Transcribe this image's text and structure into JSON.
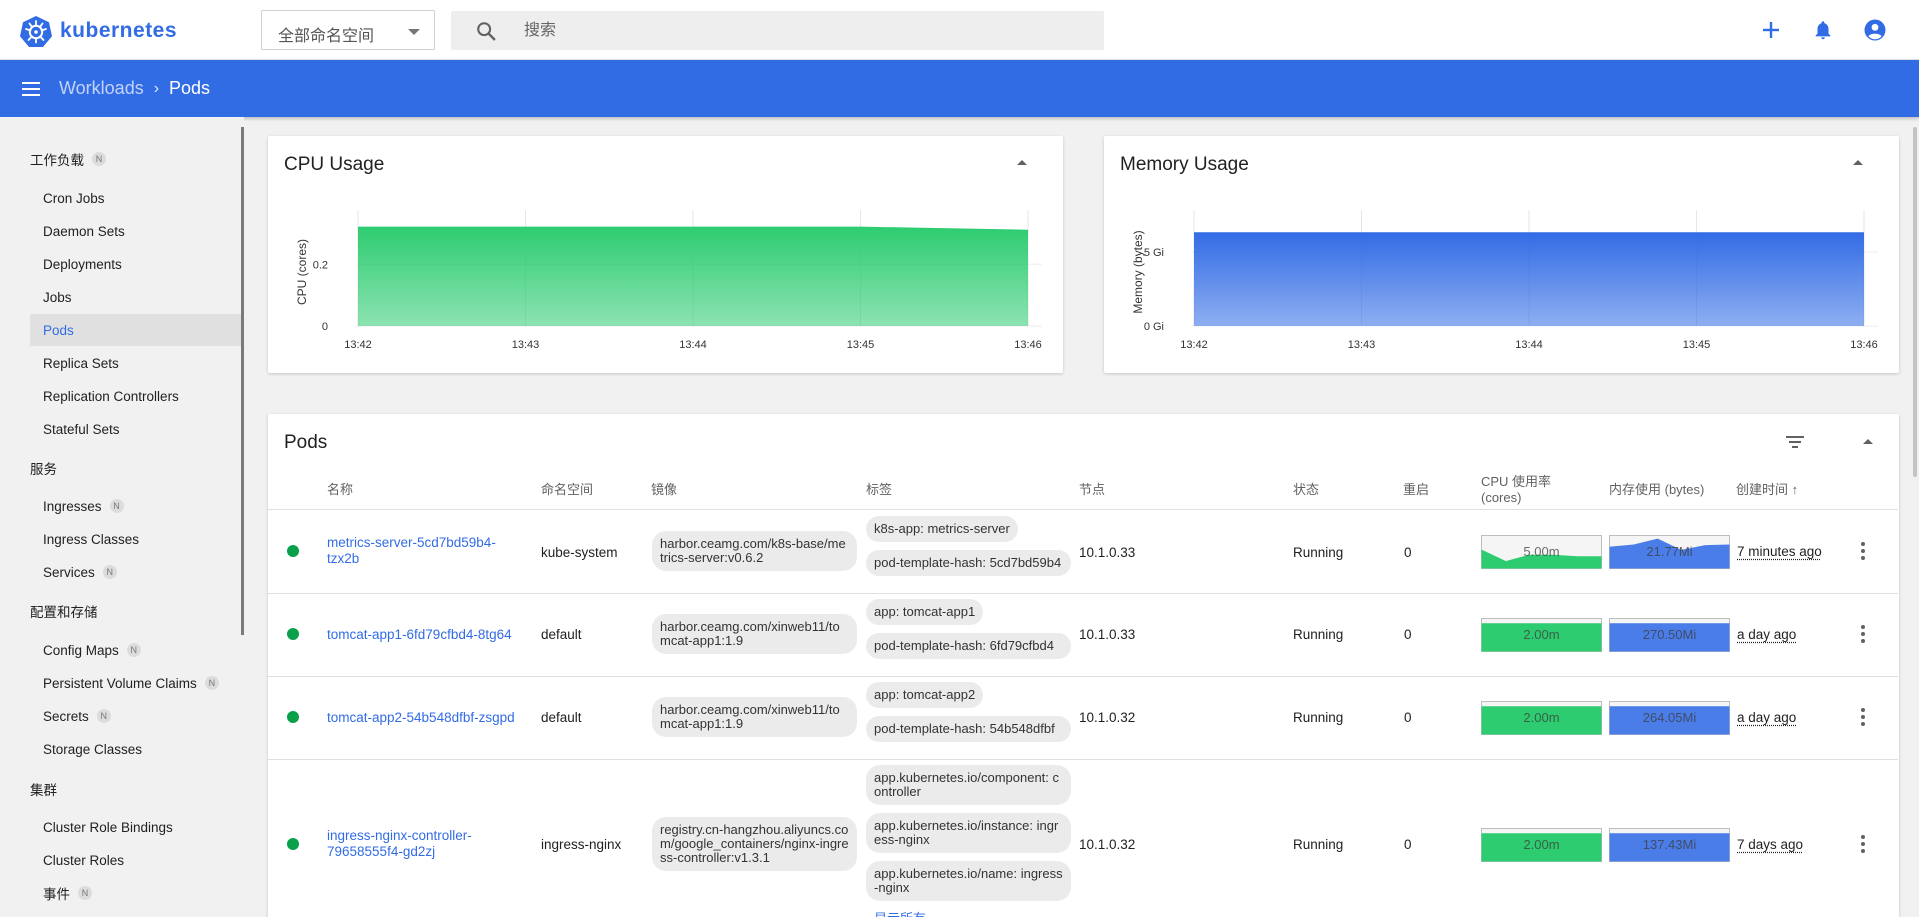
{
  "app": {
    "name": "kubernetes"
  },
  "namespace": {
    "selected": "全部命名空间"
  },
  "search": {
    "placeholder": "搜索"
  },
  "breadcrumb": {
    "parent": "Workloads",
    "separator": "›",
    "current": "Pods"
  },
  "sidebar": {
    "sections": [
      {
        "label": "工作负载",
        "badge": "N"
      },
      {
        "label": "服务",
        "badge": ""
      },
      {
        "label": "配置和存储",
        "badge": ""
      },
      {
        "label": "集群",
        "badge": ""
      }
    ],
    "items": [
      {
        "label": "Cron Jobs",
        "badge": ""
      },
      {
        "label": "Daemon Sets",
        "badge": ""
      },
      {
        "label": "Deployments",
        "badge": ""
      },
      {
        "label": "Jobs",
        "badge": ""
      },
      {
        "label": "Pods",
        "badge": "",
        "active": true
      },
      {
        "label": "Replica Sets",
        "badge": ""
      },
      {
        "label": "Replication Controllers",
        "badge": ""
      },
      {
        "label": "Stateful Sets",
        "badge": ""
      },
      {
        "label": "Ingresses",
        "badge": "N"
      },
      {
        "label": "Ingress Classes",
        "badge": ""
      },
      {
        "label": "Services",
        "badge": "N"
      },
      {
        "label": "Config Maps",
        "badge": "N"
      },
      {
        "label": "Persistent Volume Claims",
        "badge": "N"
      },
      {
        "label": "Secrets",
        "badge": "N"
      },
      {
        "label": "Storage Classes",
        "badge": ""
      },
      {
        "label": "Cluster Role Bindings",
        "badge": ""
      },
      {
        "label": "Cluster Roles",
        "badge": ""
      },
      {
        "label": "事件",
        "badge": "N"
      }
    ]
  },
  "cpu_card": {
    "title": "CPU Usage"
  },
  "memory_card": {
    "title": "Memory Usage"
  },
  "chart_data": [
    {
      "type": "area",
      "title": "CPU Usage",
      "ylabel": "CPU (cores)",
      "x": [
        "13:42",
        "13:43",
        "13:44",
        "13:45",
        "13:46"
      ],
      "y": [
        0.32,
        0.32,
        0.32,
        0.32,
        0.31
      ],
      "yticks": [
        "0",
        "0.2"
      ],
      "ylim": [
        0,
        0.35
      ],
      "color": "#2ecc71",
      "grid": true
    },
    {
      "type": "area",
      "title": "Memory Usage",
      "ylabel": "Memory (bytes)",
      "x": [
        "13:42",
        "13:43",
        "13:44",
        "13:45",
        "13:46"
      ],
      "y": [
        6.3,
        6.3,
        6.3,
        6.3,
        6.3
      ],
      "yticks": [
        "0 Gi",
        "5 Gi"
      ],
      "ylim": [
        0,
        7.3
      ],
      "unit": "Gi",
      "color": "#326ce5",
      "grid": true
    }
  ],
  "pods_card": {
    "title": "Pods",
    "columns": [
      "名称",
      "命名空间",
      "镜像",
      "标签",
      "节点",
      "状态",
      "重启",
      "CPU 使用率 (cores)",
      "内存使用 (bytes)",
      "创建时间 ↑"
    ],
    "show_all_label": "显示所有",
    "rows": [
      {
        "name": "metrics-server-5cd7bd59b4-tzx2b",
        "namespace": "kube-system",
        "image": "harbor.ceamg.com/k8s-base/metrics-server:v0.6.2",
        "labels": [
          "k8s-app: metrics-server",
          "pod-template-hash: 5cd7bd59b4"
        ],
        "node": "10.1.0.33",
        "status": "Running",
        "restarts": "0",
        "cpu": "5.00m",
        "memory": "21.77Mi",
        "cpu_trend": [
          0.55,
          0.2,
          0.4,
          0.4,
          0.35,
          0.35
        ],
        "mem_trend": [
          0.65,
          0.72,
          0.9,
          0.55,
          0.7,
          0.72
        ],
        "created": "7 minutes ago"
      },
      {
        "name": "tomcat-app1-6fd79cfbd4-8tg64",
        "namespace": "default",
        "image": "harbor.ceamg.com/xinweb11/tomcat-app1:1.9",
        "labels": [
          "app: tomcat-app1",
          "pod-template-hash: 6fd79cfbd4"
        ],
        "node": "10.1.0.33",
        "status": "Running",
        "restarts": "0",
        "cpu": "2.00m",
        "memory": "270.50Mi",
        "cpu_trend": [
          0.85,
          0.85,
          0.85,
          0.85,
          0.85,
          0.85
        ],
        "mem_trend": [
          0.85,
          0.85,
          0.85,
          0.85,
          0.85,
          0.85
        ],
        "created": "a day ago"
      },
      {
        "name": "tomcat-app2-54b548dfbf-zsgpd",
        "namespace": "default",
        "image": "harbor.ceamg.com/xinweb11/tomcat-app1:1.9",
        "labels": [
          "app: tomcat-app2",
          "pod-template-hash: 54b548dfbf"
        ],
        "node": "10.1.0.32",
        "status": "Running",
        "restarts": "0",
        "cpu": "2.00m",
        "memory": "264.05Mi",
        "cpu_trend": [
          0.85,
          0.85,
          0.85,
          0.85,
          0.85,
          0.85
        ],
        "mem_trend": [
          0.85,
          0.85,
          0.85,
          0.85,
          0.85,
          0.85
        ],
        "created": "a day ago"
      },
      {
        "name": "ingress-nginx-controller-79658555f4-gd2zj",
        "namespace": "ingress-nginx",
        "image": "registry.cn-hangzhou.aliyuncs.com/google_containers/nginx-ingress-controller:v1.3.1",
        "labels": [
          "app.kubernetes.io/component: controller",
          "app.kubernetes.io/instance: ingress-nginx",
          "app.kubernetes.io/name: ingress-nginx"
        ],
        "node": "10.1.0.32",
        "status": "Running",
        "restarts": "0",
        "cpu": "2.00m",
        "memory": "137.43Mi",
        "cpu_trend": [
          0.85,
          0.85,
          0.85,
          0.85,
          0.85,
          0.85
        ],
        "mem_trend": [
          0.85,
          0.85,
          0.85,
          0.85,
          0.85,
          0.85
        ],
        "created": "7 days ago"
      }
    ]
  }
}
